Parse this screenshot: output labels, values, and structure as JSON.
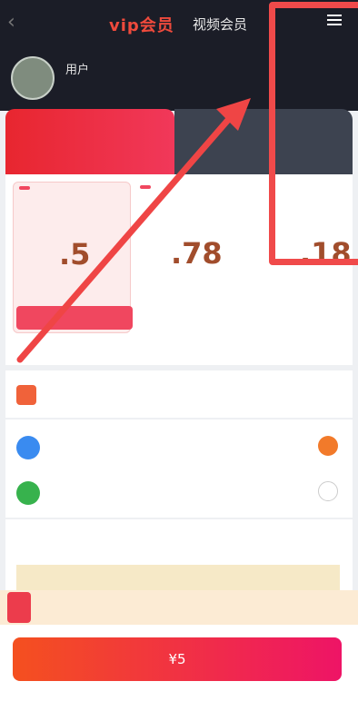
{
  "header": {
    "brand": "vip会员",
    "title": "视频会员",
    "back_icon": "chevron-left-icon",
    "menu_icon": "hamburger-menu-icon"
  },
  "profile": {
    "name": "用户",
    "vip_tag": "",
    "subtitle": ""
  },
  "tabs": [
    {
      "label": "",
      "sub": ""
    },
    {
      "label": "",
      "sub": ""
    }
  ],
  "plans": [
    {
      "tag": "",
      "name": "",
      "price": ".5",
      "per": "",
      "button": ""
    },
    {
      "tag": "",
      "name": "",
      "price": ".78",
      "per": ""
    },
    {
      "tag": "",
      "name": "",
      "price": ".18",
      "per": ""
    }
  ],
  "note": "",
  "coupon": {
    "label": "",
    "hint": "",
    "right": ""
  },
  "payment": {
    "alipay": "",
    "wechat": ""
  },
  "compare": {
    "title": "",
    "columns": [
      "",
      "",
      "",
      ""
    ]
  },
  "promo": {
    "text": "",
    "price": ""
  },
  "pay_button": "¥5",
  "colors": {
    "accent": "#f0475f",
    "highlight": "#f04a4a",
    "dark": "#1b1d27"
  }
}
